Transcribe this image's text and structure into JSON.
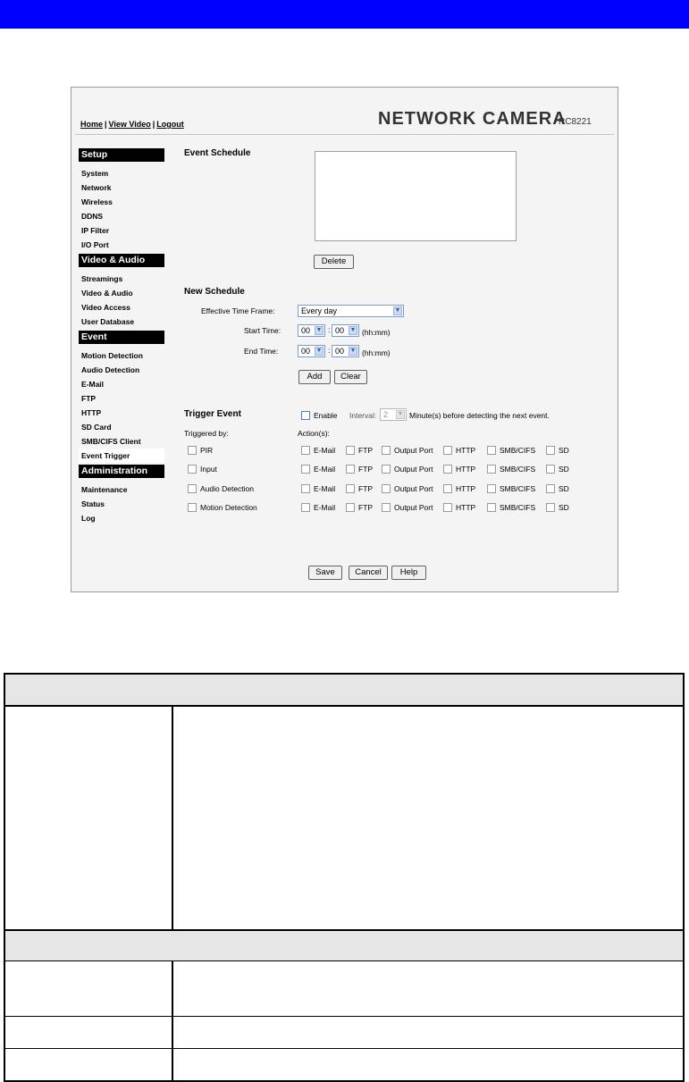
{
  "header": {
    "top_links": [
      "Home",
      "View Video",
      "Logout"
    ],
    "brand": "NETWORK CAMERA",
    "model": "RC8221"
  },
  "sidebar": {
    "sections": [
      {
        "title": "Setup",
        "items": [
          "System",
          "Network",
          "Wireless",
          "DDNS",
          "IP Filter",
          "I/O Port"
        ]
      },
      {
        "title": "Video & Audio",
        "items": [
          "Streamings",
          "Video & Audio",
          "Video Access",
          "User Database"
        ]
      },
      {
        "title": "Event",
        "items": [
          "Motion Detection",
          "Audio Detection",
          "E-Mail",
          "FTP",
          "HTTP",
          "SD Card",
          "SMB/CIFS Client",
          "Event Trigger"
        ]
      },
      {
        "title": "Administration",
        "items": [
          "Maintenance",
          "Status",
          "Log"
        ]
      }
    ],
    "active_item": "Event Trigger"
  },
  "event_schedule": {
    "title": "Event Schedule",
    "delete_label": "Delete"
  },
  "new_schedule": {
    "title": "New Schedule",
    "time_frame_label": "Effective Time Frame:",
    "time_frame_value": "Every day",
    "start_label": "Start Time:",
    "end_label": "End Time:",
    "start_hour": "00",
    "start_min": "00",
    "end_hour": "00",
    "end_min": "00",
    "colon": ":",
    "format_hint": "(hh:mm)",
    "add_label": "Add",
    "clear_label": "Clear"
  },
  "trigger_event": {
    "title": "Trigger Event",
    "enable_label": "Enable",
    "interval_label": "Interval:",
    "interval_value": "2",
    "interval_suffix": "Minute(s) before detecting the next event.",
    "triggered_by_label": "Triggered by:",
    "actions_label": "Action(s):",
    "triggers": [
      "PIR",
      "Input",
      "Audio Detection",
      "Motion Detection"
    ],
    "actions": [
      "E-Mail",
      "FTP",
      "Output Port",
      "HTTP",
      "SMB/CIFS",
      "SD"
    ]
  },
  "footer_buttons": {
    "save": "Save",
    "cancel": "Cancel",
    "help": "Help"
  }
}
